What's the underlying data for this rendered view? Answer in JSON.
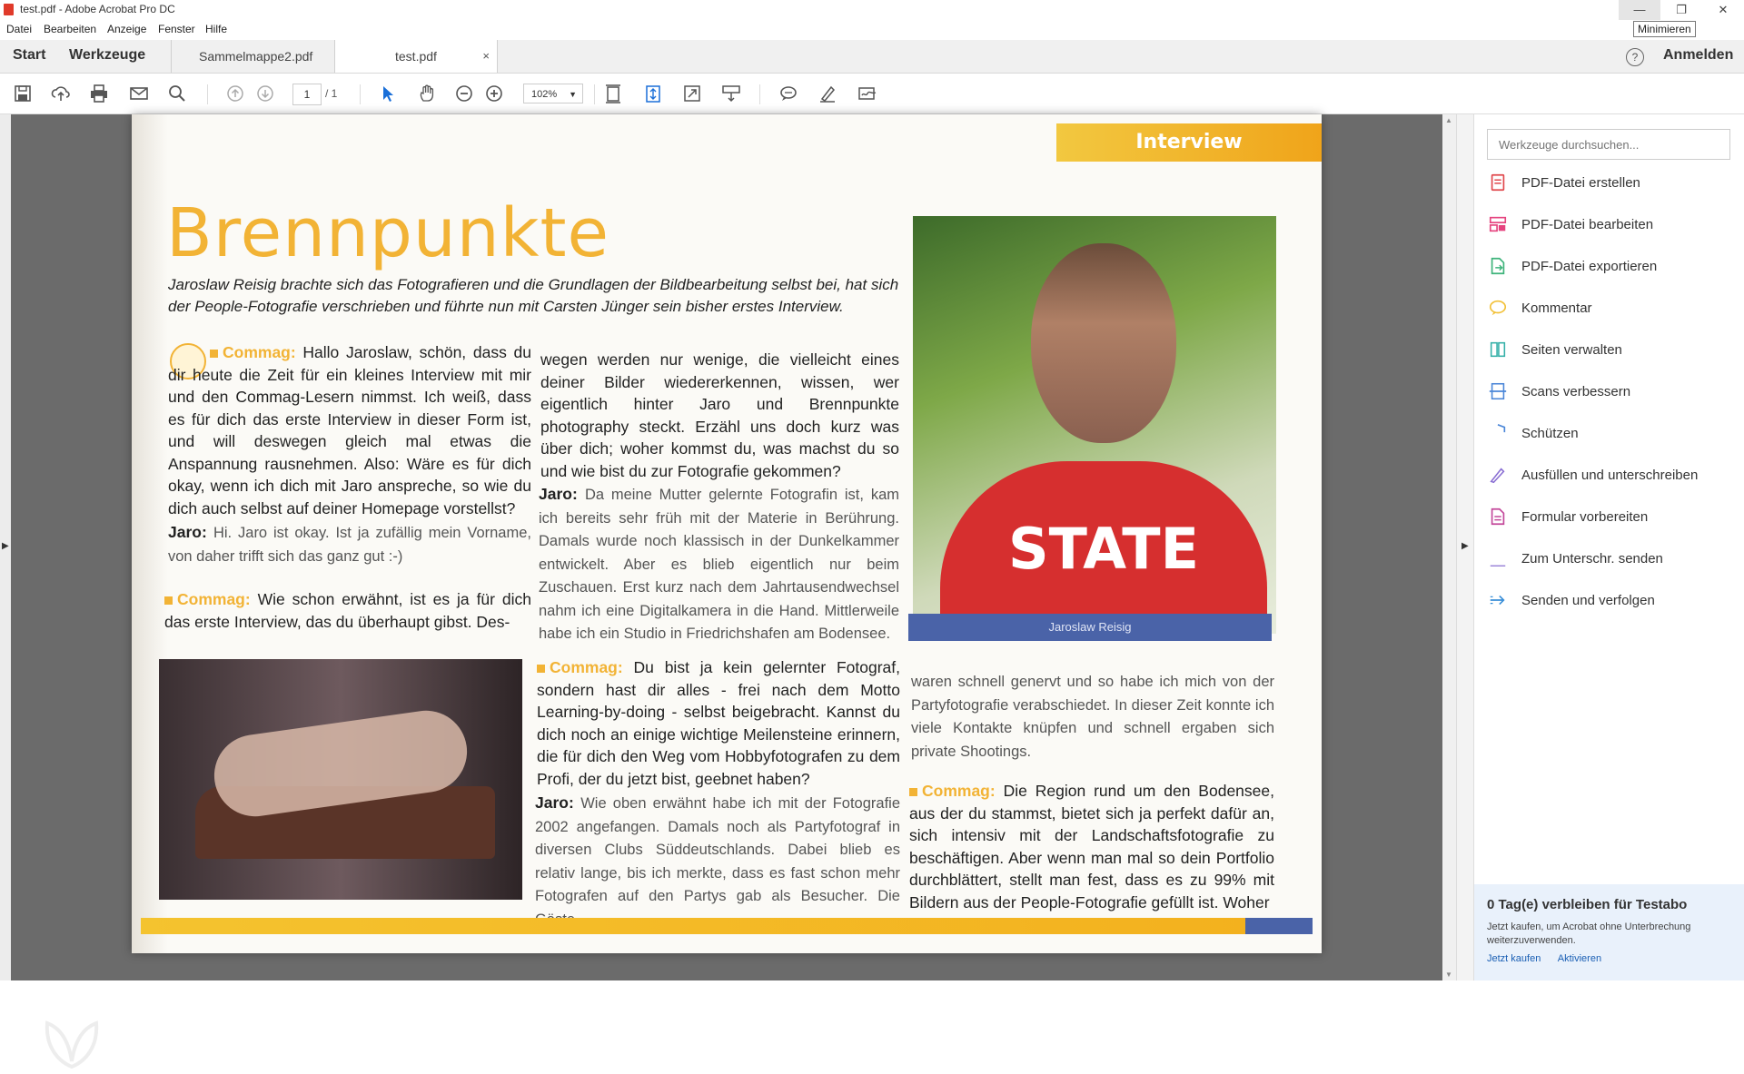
{
  "window": {
    "title": "test.pdf - Adobe Acrobat Pro DC",
    "minimize_glyph": "—",
    "maximize_glyph": "❐",
    "close_glyph": "✕",
    "tooltip": "Minimieren"
  },
  "menu": [
    "Datei",
    "Bearbeiten",
    "Anzeige",
    "Fenster",
    "Hilfe"
  ],
  "tabs": {
    "start": "Start",
    "werkzeuge": "Werkzeuge",
    "documents": [
      {
        "label": "Sammelmappe2.pdf",
        "active": false
      },
      {
        "label": "test.pdf",
        "active": true
      }
    ],
    "close_glyph": "×",
    "help_glyph": "?",
    "signin": "Anmelden"
  },
  "toolbar": {
    "page_current": "1",
    "page_total": "/ 1",
    "zoom": "102%",
    "icons": [
      "save-icon",
      "upload-icon",
      "print-icon",
      "mail-icon",
      "search-icon",
      "page-up-icon",
      "page-down-icon",
      "select-arrow-icon",
      "hand-icon",
      "zoom-out-icon",
      "zoom-in-icon",
      "fit-page-icon",
      "scroll-mode-icon",
      "full-screen-icon",
      "read-mode-icon",
      "comment-icon",
      "highlight-pen-icon",
      "sign-icon"
    ]
  },
  "article": {
    "banner": "Interview",
    "headline": "Brennpunkte",
    "lead": "Jaroslaw Reisig brachte sich das Fotografieren und die Grundlagen der Bildbearbeitung selbst bei, hat sich der People-Fotografie verschrieben und führte nun mit Carsten Jünger sein bisher erstes Interview.",
    "col1": {
      "q1_label": "Commag:",
      "q1": "Hallo Jaroslaw, schön, dass du dir heute die Zeit für ein kleines Interview mit mir und den Commag-Lesern nimmst. Ich weiß, dass es für dich das erste Interview in dieser Form ist, und will deswegen gleich mal etwas die Anspannung rausnehmen. Also: Wäre es für dich okay, wenn ich dich mit Jaro anspreche, so wie du dich auch selbst auf deiner Homepage vorstellst?",
      "a1_label": "Jaro:",
      "a1": "Hi. Jaro ist okay. Ist ja zufällig mein Vorname, von daher trifft sich das ganz gut :-)",
      "q2_label": "Commag:",
      "q2": "Wie schon erwähnt, ist es ja für dich das erste Interview, das du überhaupt gibst. Des-"
    },
    "col2": {
      "q_cont": "wegen werden nur wenige, die vielleicht eines deiner Bilder wiedererkennen, wissen, wer eigentlich hinter Jaro und Brennpunkte photography steckt. Erzähl uns doch kurz was über dich; woher kommst du, was machst du so und wie bist du zur Fotografie gekommen?",
      "a_label": "Jaro:",
      "a": "Da meine Mutter gelernte Fotografin ist, kam ich bereits sehr früh mit der Materie in Berührung. Damals wurde noch klassisch in der Dunkelkammer entwickelt. Aber es blieb eigentlich nur beim Zuschauen. Erst kurz nach dem Jahrtausendwechsel nahm ich eine Digitalkamera in die Hand. Mittlerweile habe ich ein Studio in Friedrichshafen am Bodensee.",
      "q3_label": "Commag:",
      "q3": "Du bist ja kein gelernter Fotograf, sondern hast dir alles - frei nach dem Motto Learning-by-doing - selbst beigebracht. Kannst du dich noch an einige wichtige Meilensteine erinnern, die für dich den Weg vom Hobbyfotografen zu dem Profi, der du jetzt bist, geebnet haben?",
      "a3_label": "Jaro:",
      "a3": "Wie oben erwähnt habe ich mit der Fotografie 2002 angefangen. Damals noch als Partyfotograf in diversen Clubs Süddeutschlands. Dabei blieb es relativ lange, bis ich merkte, dass es fast schon mehr Fotografen auf den Partys gab als Besucher. Die Gäste"
    },
    "col3": {
      "a_cont": "waren schnell genervt und so habe ich mich von der Partyfotografie verabschiedet. In dieser Zeit konnte ich viele Kontakte knüpfen und schnell ergaben sich private Shootings.",
      "q4_label": "Commag:",
      "q4": "Die Region rund um den Bodensee, aus der du stammst, bietet sich ja perfekt dafür an, sich intensiv mit der Landschaftsfotografie zu beschäftigen. Aber wenn man mal so dein Portfolio durchblättert, stellt man fest, dass es zu 99% mit Bildern aus der People-Fotografie gefüllt ist. Woher"
    },
    "caption": "Jaroslaw Reisig",
    "shirt_text": "STATE"
  },
  "tools_panel": {
    "search_placeholder": "Werkzeuge durchsuchen...",
    "items": [
      {
        "label": "PDF-Datei erstellen",
        "icon": "create-pdf-icon",
        "color": "#e0474c"
      },
      {
        "label": "PDF-Datei bearbeiten",
        "icon": "edit-pdf-icon",
        "color": "#e5437e"
      },
      {
        "label": "PDF-Datei exportieren",
        "icon": "export-pdf-icon",
        "color": "#3db37a"
      },
      {
        "label": "Kommentar",
        "icon": "comment-tool-icon",
        "color": "#f2c13a"
      },
      {
        "label": "Seiten verwalten",
        "icon": "organize-pages-icon",
        "color": "#34b0a8"
      },
      {
        "label": "Scans verbessern",
        "icon": "enhance-scans-icon",
        "color": "#4a86d8"
      },
      {
        "label": "Schützen",
        "icon": "protect-shield-icon",
        "color": "#4a86d8"
      },
      {
        "label": "Ausfüllen und unterschreiben",
        "icon": "fill-sign-icon",
        "color": "#8a6fd3"
      },
      {
        "label": "Formular vorbereiten",
        "icon": "prepare-form-icon",
        "color": "#c3479a"
      },
      {
        "label": "Zum Unterschr. senden",
        "icon": "send-for-signature-icon",
        "color": "#8a6fd3"
      },
      {
        "label": "Senden und verfolgen",
        "icon": "send-track-icon",
        "color": "#3a8fd8"
      }
    ],
    "trial": {
      "title": "0 Tag(e) verbleiben für Testabo",
      "text": "Jetzt kaufen, um Acrobat ohne Unterbrechung weiterzuverwenden.",
      "buy": "Jetzt kaufen",
      "activate": "Aktivieren"
    }
  }
}
